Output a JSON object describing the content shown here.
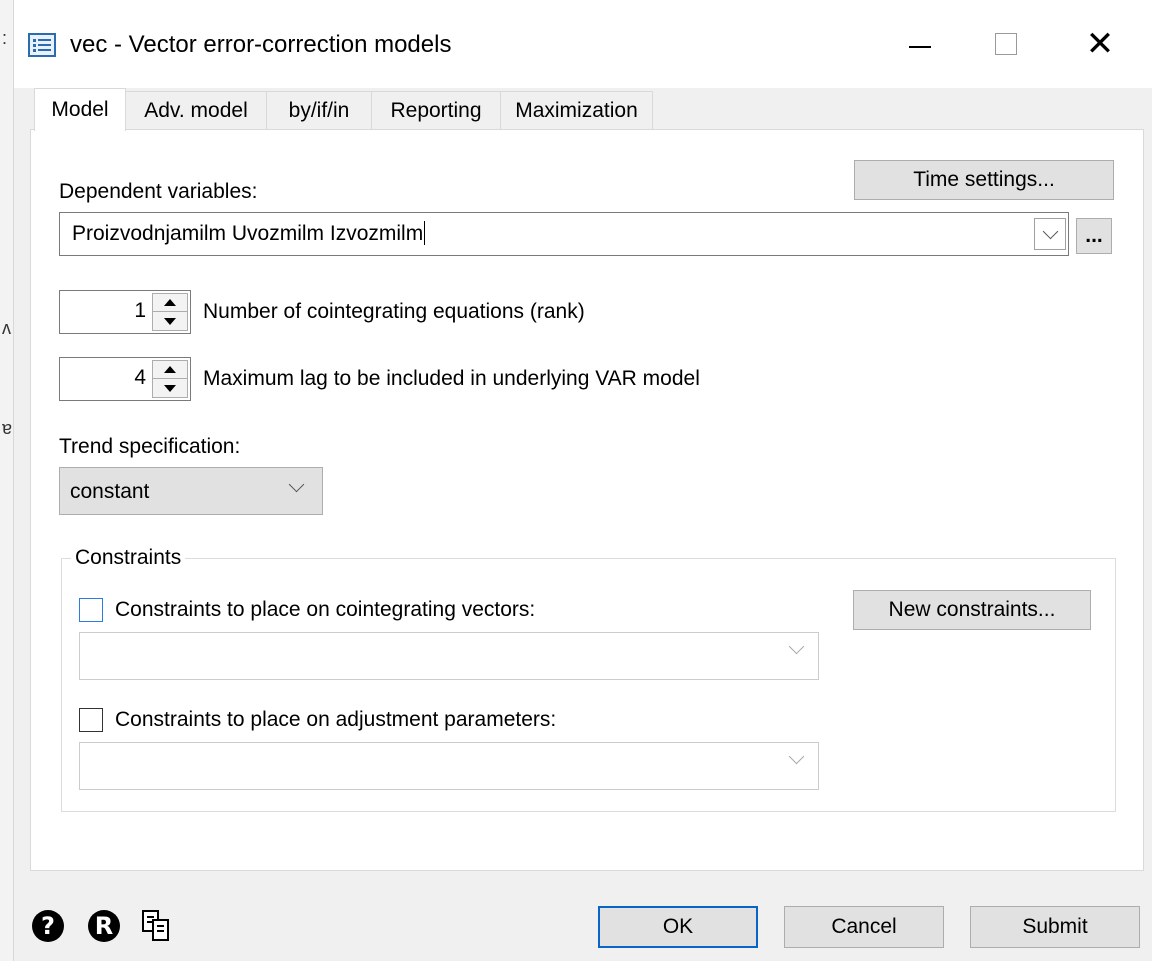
{
  "window": {
    "title": "vec - Vector error-correction models",
    "icon": "dialog-list-icon"
  },
  "tabs": [
    {
      "label": "Model",
      "active": true
    },
    {
      "label": "Adv. model",
      "active": false
    },
    {
      "label": "by/if/in",
      "active": false
    },
    {
      "label": "Reporting",
      "active": false
    },
    {
      "label": "Maximization",
      "active": false
    }
  ],
  "model": {
    "time_settings_label": "Time settings...",
    "dependent_label": "Dependent variables:",
    "dependent_value": "Proizvodnjamilm Uvozmilm Izvozmilm",
    "browse_label": "...",
    "rank_value": "1",
    "rank_label": "Number of cointegrating equations (rank)",
    "lag_value": "4",
    "lag_label": "Maximum lag to be included in underlying VAR model",
    "trend_label": "Trend specification:",
    "trend_value": "constant"
  },
  "constraints": {
    "legend": "Constraints",
    "cointegrating_label": "Constraints to place on cointegrating vectors:",
    "cointegrating_checked": false,
    "new_constraints_label": "New constraints...",
    "adjustment_label": "Constraints to place on adjustment parameters:",
    "adjustment_checked": false
  },
  "footer": {
    "ok_label": "OK",
    "cancel_label": "Cancel",
    "submit_label": "Submit"
  },
  "colors": {
    "focus_border": "#0a64c8",
    "panel_bg": "#ffffff",
    "dialog_bg": "#f0f0f0"
  }
}
